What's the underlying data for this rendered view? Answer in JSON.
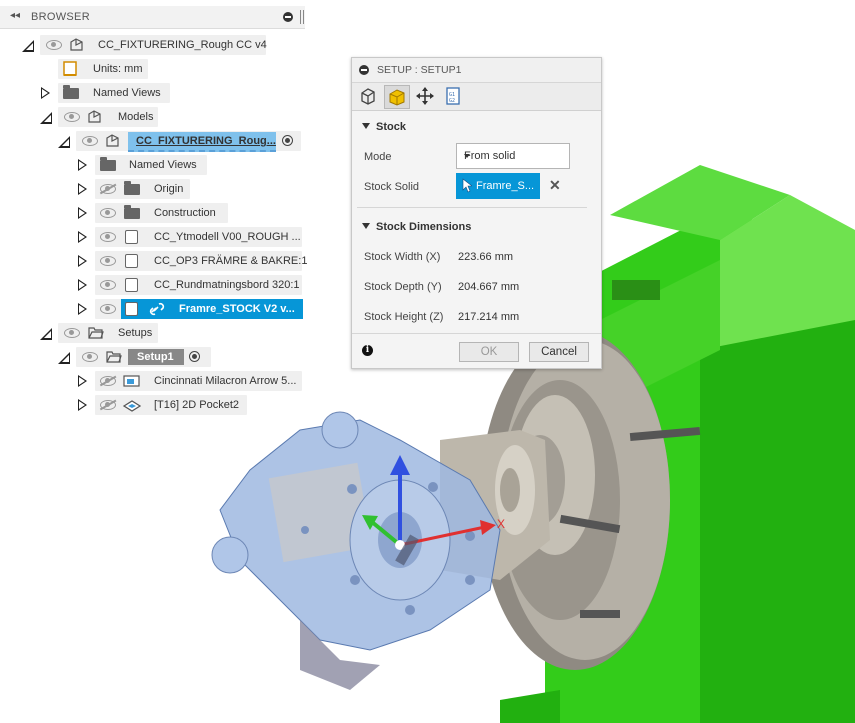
{
  "browser": {
    "title": "BROWSER",
    "root": "CC_FIXTURERING_Rough CC v4",
    "units": "Units: mm",
    "named_views": "Named Views",
    "models": "Models",
    "component": "CC_FIXTURERING_Roug...",
    "comp_named_views": "Named Views",
    "origin": "Origin",
    "construction": "Construction",
    "body1": "CC_Ytmodell V00_ROUGH ...",
    "body2": "CC_OP3 FRÄMRE & BAKRE:1",
    "body3": "CC_Rundmatningsbord 320:1",
    "body4": "Framre_STOCK V2 v...",
    "setups": "Setups",
    "setup1": "Setup1",
    "machine": "Cincinnati Milacron Arrow 5...",
    "operation": "[T16] 2D Pocket2"
  },
  "dialog": {
    "title": "SETUP : SETUP1",
    "stock_section": "Stock",
    "mode_label": "Mode",
    "mode_value": "From solid",
    "stock_solid_label": "Stock Solid",
    "stock_solid_value": "Framre_S...",
    "dims_section": "Stock Dimensions",
    "width_label": "Stock Width (X)",
    "width_value": "223.66 mm",
    "depth_label": "Stock Depth (Y)",
    "depth_value": "204.667 mm",
    "height_label": "Stock Height (Z)",
    "height_value": "217.214 mm",
    "ok": "OK",
    "cancel": "Cancel"
  },
  "viewport": {
    "axis_x": "X",
    "colors": {
      "fixture_green": "#33cc1a",
      "chuck_gray": "#a8a39a",
      "part_blue": "#9fb8e0",
      "x_axis": "#e03030",
      "y_axis": "#30c030",
      "z_axis": "#3050e0"
    }
  }
}
